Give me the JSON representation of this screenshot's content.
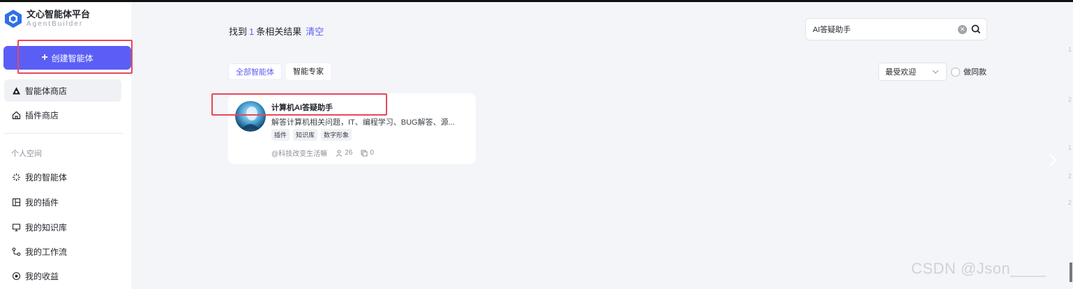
{
  "app": {
    "title": "文心智能体平台",
    "subtitle": "AgentBuilder"
  },
  "sidebar": {
    "create_label": "创建智能体",
    "items": [
      {
        "label": "智能体商店",
        "icon": "store-icon"
      },
      {
        "label": "插件商店",
        "icon": "home-icon"
      }
    ],
    "section_label": "个人空间",
    "personal": [
      {
        "label": "我的智能体",
        "icon": "sparkle-icon"
      },
      {
        "label": "我的插件",
        "icon": "layout-icon"
      },
      {
        "label": "我的知识库",
        "icon": "monitor-icon"
      },
      {
        "label": "我的工作流",
        "icon": "workflow-icon"
      },
      {
        "label": "我的收益",
        "icon": "coin-icon"
      }
    ]
  },
  "results": {
    "prefix": "找到",
    "count": "1",
    "suffix": "条相关结果",
    "clear": "清空"
  },
  "search": {
    "value": "AI答疑助手"
  },
  "tabs": [
    {
      "label": "全部智能体",
      "active": true
    },
    {
      "label": "智能专家",
      "active": false
    }
  ],
  "sort": {
    "selected": "最受欢迎"
  },
  "filter": {
    "label": "做同款"
  },
  "card": {
    "title": "计算机AI答疑助手",
    "description": "解答计算机相关问题，IT、编程学习、BUG解答、源...",
    "tags": [
      "插件",
      "知识库",
      "数字形象"
    ],
    "author": "@科技改变生活嘛",
    "users": "26",
    "copies": "0"
  },
  "edge_chars": [
    "1",
    "2",
    "1",
    "2",
    "2"
  ],
  "watermark": "CSDN @Json____",
  "colors": {
    "accent": "#5b5ef5",
    "highlight": "#e8475b"
  }
}
